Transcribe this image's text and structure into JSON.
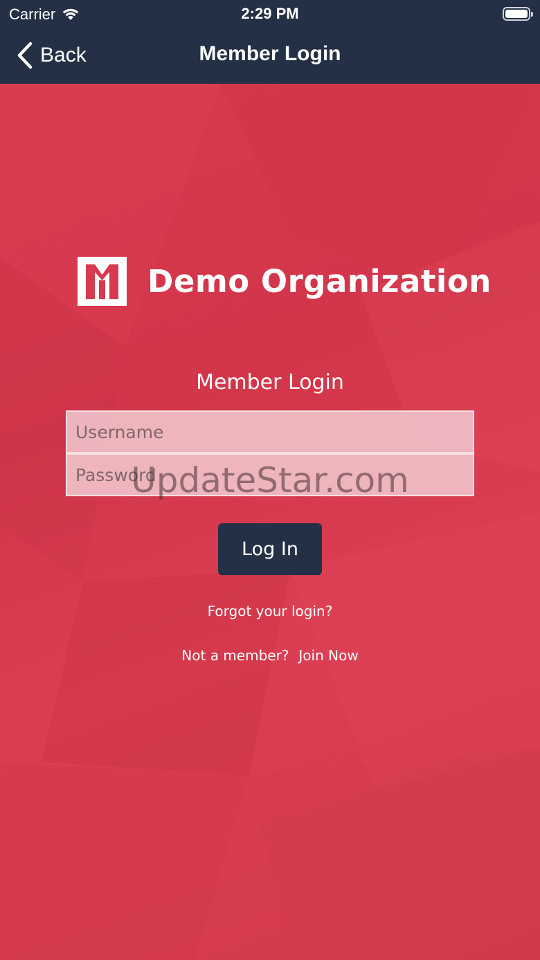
{
  "status_bar": {
    "carrier": "Carrier",
    "time": "2:29 PM",
    "battery_level": 1.0
  },
  "nav_bar": {
    "back_label": "Back",
    "title": "Member Login"
  },
  "brand": {
    "org_name": "Demo Organization",
    "logo_icon": "org-logo-icon"
  },
  "login_form": {
    "heading": "Member Login",
    "username_placeholder": "Username",
    "password_placeholder": "Password",
    "submit_label": "Log In",
    "forgot_label": "Forgot your login?",
    "not_member_label": "Not a member?",
    "join_label": "Join Now"
  },
  "watermark": "UpdateStar.com",
  "colors": {
    "header_bg": "#233045",
    "background": "#d63a4e",
    "button_bg": "#233045",
    "text": "#ffffff"
  }
}
